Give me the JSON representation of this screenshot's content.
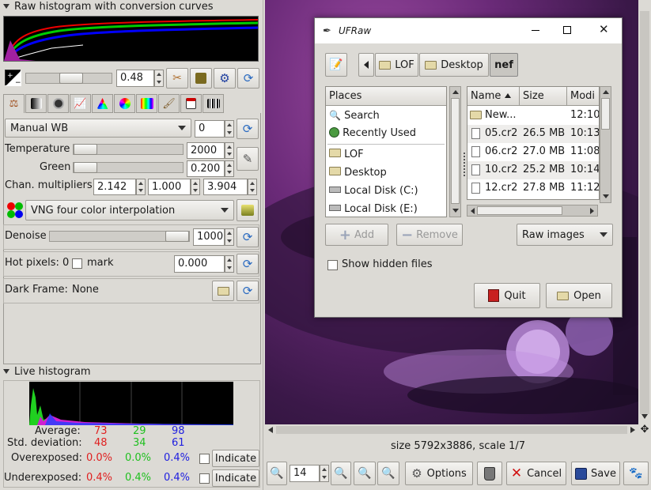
{
  "left_panel": {
    "raw_histogram_title": "Raw histogram with conversion curves",
    "exposure_value": "0.48",
    "wb_preset": "Manual WB",
    "wb_fine_tune": "0",
    "temperature_label": "Temperature",
    "temperature_value": "2000",
    "green_label": "Green",
    "green_value": "0.200",
    "chan_label": "Chan. multipliers:",
    "chan_values": [
      "2.142",
      "1.000",
      "3.904"
    ],
    "interpolation": "VNG four color interpolation",
    "denoise_label": "Denoise",
    "denoise_value": "1000",
    "hot_pixels_label": "Hot pixels: 0",
    "hot_mark_label": "mark",
    "hot_value": "0.000",
    "dark_frame_label": "Dark Frame:",
    "dark_frame_value": "None",
    "live_histogram_title": "Live histogram",
    "stats": {
      "average_label": "Average:",
      "stddev_label": "Std. deviation:",
      "over_label": "Overexposed:",
      "under_label": "Underexposed:",
      "average": [
        "73",
        "29",
        "98"
      ],
      "stddev": [
        "48",
        "34",
        "61"
      ],
      "over": [
        "0.0%",
        "0.0%",
        "0.4%"
      ],
      "under": [
        "0.4%",
        "0.4%",
        "0.4%"
      ],
      "indicate_label": "Indicate"
    },
    "colors": {
      "red": "#e02020",
      "green": "#20c020",
      "blue": "#2020e0"
    }
  },
  "preview": {
    "status": "size 5792x3886, scale 1/7"
  },
  "bottom_bar": {
    "zoom_value": "14",
    "options_label": "Options",
    "cancel_label": "Cancel",
    "save_label": "Save"
  },
  "dialog": {
    "title": "UFRaw",
    "path": [
      "LOF",
      "Desktop",
      "nef"
    ],
    "places_header": "Places",
    "places": [
      {
        "label": "Search",
        "icon": "search-icon"
      },
      {
        "label": "Recently Used",
        "icon": "clock-icon"
      },
      {
        "label": "LOF",
        "icon": "folder-icon"
      },
      {
        "label": "Desktop",
        "icon": "folder-icon"
      },
      {
        "label": "Local Disk (C:)",
        "icon": "drive-icon"
      },
      {
        "label": "Local Disk (E:)",
        "icon": "drive-icon"
      }
    ],
    "columns": [
      "Name",
      "Size",
      "Modi"
    ],
    "files": [
      {
        "name": "New...",
        "size": "",
        "modified": "12:10",
        "icon": "folder-icon"
      },
      {
        "name": "05.cr2",
        "size": "26.5 MB",
        "modified": "10:13",
        "icon": "file-icon"
      },
      {
        "name": "06.cr2",
        "size": "27.0 MB",
        "modified": "11:08",
        "icon": "file-icon"
      },
      {
        "name": "10.cr2",
        "size": "25.2 MB",
        "modified": "10:14",
        "icon": "file-icon"
      },
      {
        "name": "12.cr2",
        "size": "27.8 MB",
        "modified": "11:12",
        "icon": "file-icon"
      }
    ],
    "add_label": "Add",
    "remove_label": "Remove",
    "filter_label": "Raw images",
    "show_hidden_label": "Show hidden files",
    "quit_label": "Quit",
    "open_label": "Open"
  }
}
